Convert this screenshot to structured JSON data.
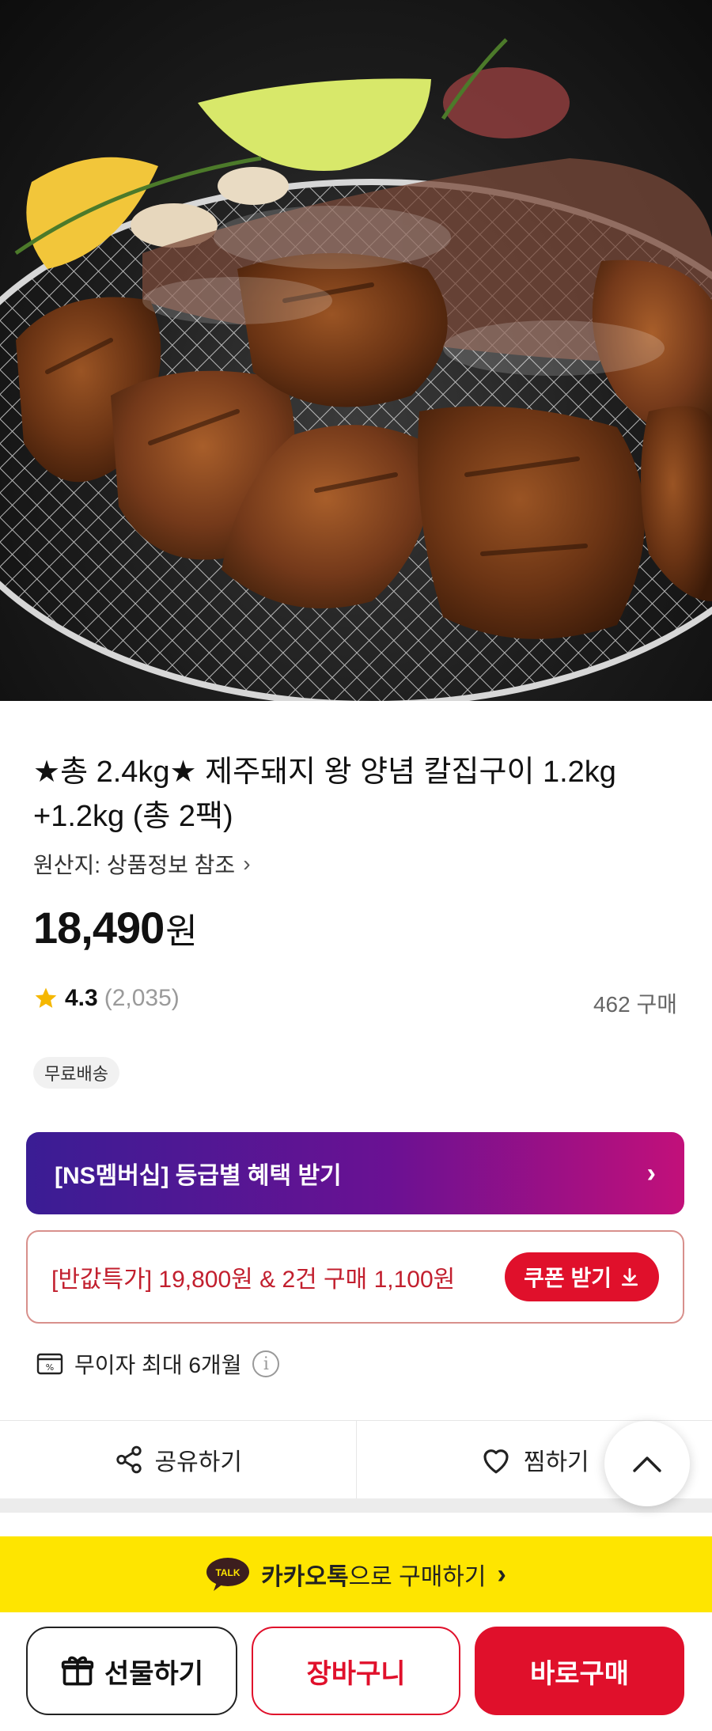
{
  "hero": {
    "alt": ""
  },
  "product": {
    "title": "★총 2.4kg★ 제주돼지 왕 양념 칼집구이 1.2kg +1.2kg (총 2팩)",
    "origin": "원산지: 상품정보 참조",
    "origin_chevron": "›",
    "price_value": "18,490",
    "price_unit": "원",
    "rating_score": "4.3",
    "rating_count": "(2,035)",
    "purchase_count": "462 구매",
    "badge": "무료배송",
    "star_color": "#f5b700"
  },
  "membership": {
    "label": "[NS멤버십] 등급별 혜택 받기",
    "chevron": "›"
  },
  "coupon": {
    "label": "[반값특가] 19,800원 & 2건 구매 1,100원",
    "button": "쿠폰 받기"
  },
  "installment": {
    "label": "무이자 최대 6개월",
    "info": "i"
  },
  "actions": {
    "share": "공유하기",
    "wish": "찜하기"
  },
  "kakao": {
    "badge": "TALK",
    "bold": "카카오톡",
    "rest": "으로 구매하기",
    "chevron": "›"
  },
  "bottom": {
    "gift": "선물하기",
    "cart": "장바구니",
    "buy": "바로구매"
  },
  "colors": {
    "accent_red": "#e0102b",
    "kakao_yellow": "#fee500",
    "membership_from": "#3a1d94",
    "membership_to": "#c2107a"
  }
}
